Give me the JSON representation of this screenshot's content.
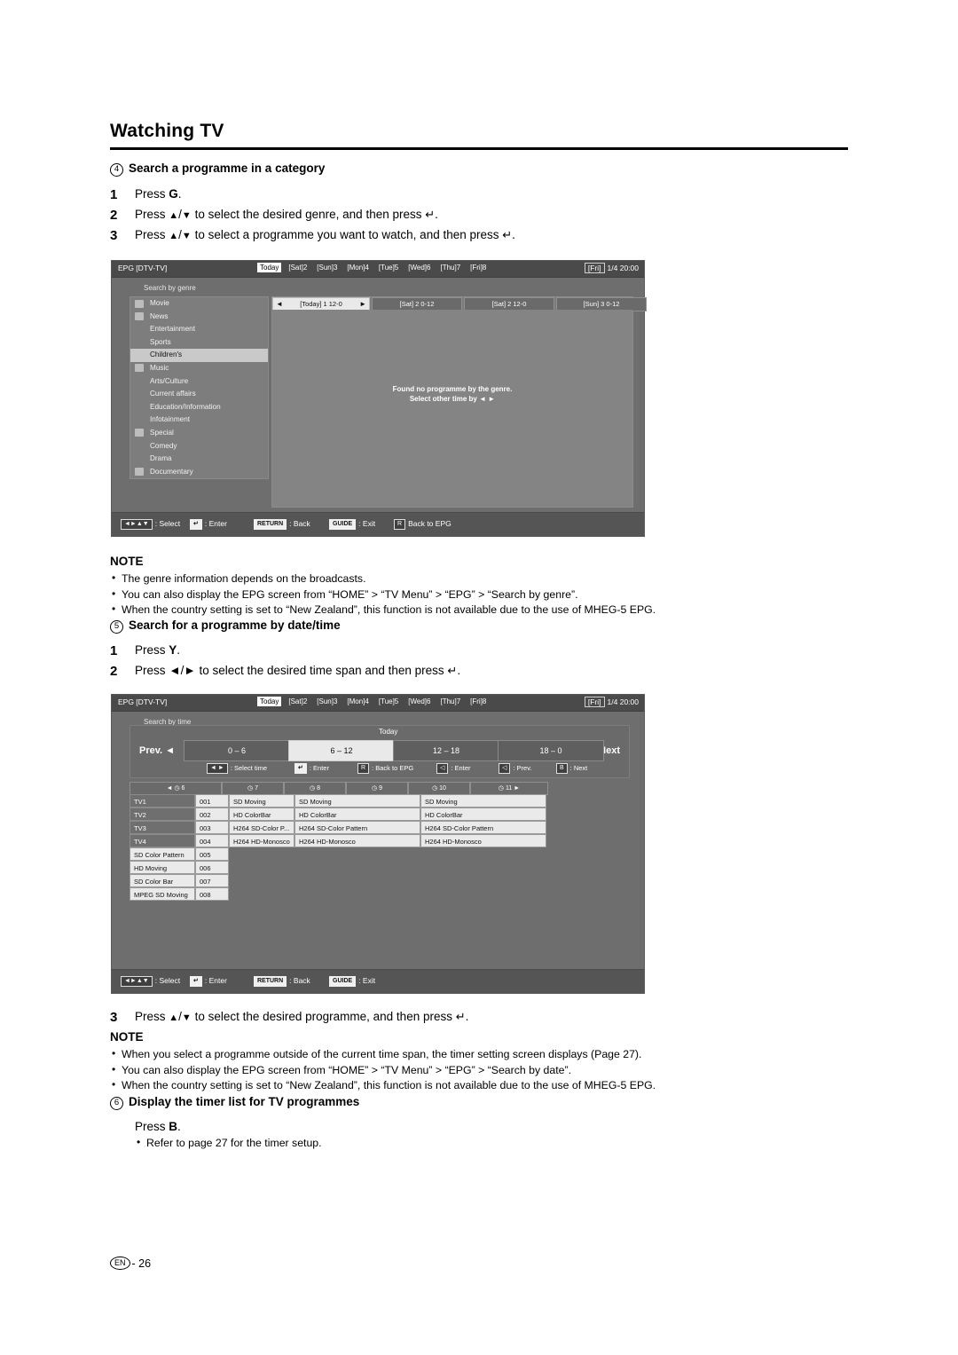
{
  "page": {
    "title": "Watching TV",
    "footer_lang": "EN",
    "footer_page": "26"
  },
  "section4": {
    "marker": "4",
    "heading": "Search a programme in a category",
    "steps": [
      {
        "num": "1",
        "text": "Press G."
      },
      {
        "num": "2",
        "text": "Press ▲/▼ to select the desired genre, and then press ↲."
      },
      {
        "num": "3",
        "text": "Press ▲/▼ to select a programme you want to watch, and then press ↲."
      }
    ]
  },
  "epg_genre": {
    "label": "EPG [DTV-TV]",
    "days": [
      "Today",
      "[Sat]2",
      "[Sun]3",
      "[Mon]4",
      "[Tue]5",
      "[Wed]6",
      "[Thu]7",
      "[Fri]8"
    ],
    "selected_day": "Today",
    "clock_day": "[Fri]",
    "clock_date": "1/4",
    "clock_time": "20:00",
    "sub_label": "Search by genre",
    "genres": [
      {
        "label": "Movie",
        "icon": true,
        "selected": false
      },
      {
        "label": "News",
        "icon": true,
        "selected": false
      },
      {
        "label": "Entertainment",
        "icon": false,
        "selected": false
      },
      {
        "label": "Sports",
        "icon": false,
        "selected": false
      },
      {
        "label": "Children's",
        "icon": false,
        "selected": true
      },
      {
        "label": "Music",
        "icon": true,
        "selected": false
      },
      {
        "label": "Arts/Culture",
        "icon": false,
        "selected": false
      },
      {
        "label": "Current affairs",
        "icon": false,
        "selected": false
      },
      {
        "label": "Education/Information",
        "icon": false,
        "selected": false
      },
      {
        "label": "Infotainment",
        "icon": false,
        "selected": false
      },
      {
        "label": "Special",
        "icon": true,
        "selected": false
      },
      {
        "label": "Comedy",
        "icon": false,
        "selected": false
      },
      {
        "label": "Drama",
        "icon": false,
        "selected": false
      },
      {
        "label": "Documentary",
        "icon": true,
        "selected": false
      }
    ],
    "columns": [
      {
        "label": "[Today] 1 12-0",
        "selected": true
      },
      {
        "label": "[Sat] 2 0-12",
        "selected": false
      },
      {
        "label": "[Sat] 2 12-0",
        "selected": false
      },
      {
        "label": "[Sun] 3 0-12",
        "selected": false
      }
    ],
    "message_line1": "Found no programme by the genre.",
    "message_line2": "Select other time by ◄ ►",
    "legend": [
      {
        "key": "◄►▲▼",
        "text": ": Select",
        "style": "plain"
      },
      {
        "key": "↲",
        "text": ": Enter",
        "style": "white"
      },
      {
        "key": "RETURN",
        "text": ": Back",
        "style": "white"
      },
      {
        "key": "GUIDE",
        "text": ": Exit",
        "style": "white"
      },
      {
        "key": "R",
        "text": "Back to EPG",
        "style": "plain"
      }
    ]
  },
  "note1": {
    "title": "NOTE",
    "items": [
      "The genre information depends on the broadcasts.",
      "You can also display the EPG screen from “HOME” > “TV Menu” > “EPG” > “Search by genre”.",
      "When the country setting is set to “New Zealand”, this function is not available due to the use of MHEG-5 EPG."
    ]
  },
  "section5": {
    "marker": "5",
    "heading": "Search for a programme by date/time",
    "steps": [
      {
        "num": "1",
        "text": "Press Y."
      },
      {
        "num": "2",
        "text": "Press ◄/► to select the desired time span and then press ↲."
      }
    ],
    "step3": {
      "num": "3",
      "text": "Press ▲/▼ to select the desired programme, and then press ↲."
    }
  },
  "epg_time": {
    "label": "EPG [DTV-TV]",
    "days": [
      "Today",
      "[Sat]2",
      "[Sun]3",
      "[Mon]4",
      "[Tue]5",
      "[Wed]6",
      "[Thu]7",
      "[Fri]8"
    ],
    "selected_day": "Today",
    "clock_day": "[Fri]",
    "clock_date": "1/4",
    "clock_time": "20:00",
    "sub_label": "Search by time",
    "today_label": "Today",
    "prev_label": "Prev.",
    "next_label": "Next",
    "spans": [
      {
        "label": "0 – 6",
        "selected": false
      },
      {
        "label": "6 – 12",
        "selected": true
      },
      {
        "label": "12 – 18",
        "selected": false
      },
      {
        "label": "18 – 0",
        "selected": false
      }
    ],
    "inner_legend": [
      {
        "key": "◄ ►",
        "text": ": Select time",
        "style": "plain"
      },
      {
        "key": "↲",
        "text": ": Enter",
        "style": "white"
      },
      {
        "key": "R",
        "text": ": Back to EPG",
        "style": "plain"
      },
      {
        "key": "◁",
        "text": ": Enter",
        "style": "plain"
      },
      {
        "key": "◁",
        "text": ": Prev.",
        "style": "plain"
      },
      {
        "key": "B",
        "text": ": Next",
        "style": "plain"
      }
    ],
    "hour_headers": [
      "6",
      "7",
      "8",
      "9",
      "10",
      "11"
    ],
    "channels": [
      {
        "name": "TV1",
        "num": "001",
        "cells": [
          "SD Moving",
          "SD Moving",
          "SD Moving"
        ]
      },
      {
        "name": "TV2",
        "num": "002",
        "cells": [
          "HD ColorBar",
          "HD ColorBar",
          "HD ColorBar"
        ]
      },
      {
        "name": "TV3",
        "num": "003",
        "cells": [
          "H264 SD-Color P...",
          "H264 SD-Color Pattern",
          "H264 SD-Color Pattern"
        ]
      },
      {
        "name": "TV4",
        "num": "004",
        "cells": [
          "H264 HD-Monosco",
          "H264 HD-Monosco",
          "H264 HD-Monosco"
        ]
      },
      {
        "name": "SD Color Pattern",
        "num": "005",
        "cells": []
      },
      {
        "name": "HD Moving",
        "num": "006",
        "cells": []
      },
      {
        "name": "SD Color Bar",
        "num": "007",
        "cells": []
      },
      {
        "name": "MPEG SD Moving",
        "num": "008",
        "cells": []
      }
    ],
    "legend": [
      {
        "key": "◄►▲▼",
        "text": ": Select",
        "style": "plain"
      },
      {
        "key": "↲",
        "text": ": Enter",
        "style": "white"
      },
      {
        "key": "RETURN",
        "text": ": Back",
        "style": "white"
      },
      {
        "key": "GUIDE",
        "text": ": Exit",
        "style": "white"
      }
    ]
  },
  "note2": {
    "title": "NOTE",
    "items": [
      "When you select a programme outside of the current time span, the timer setting screen displays (Page 27).",
      "You can also display the EPG screen from “HOME” > “TV Menu” > “EPG” > “Search by date”.",
      "When the country setting is set to “New Zealand”, this function is not available due to the use of MHEG-5 EPG."
    ]
  },
  "section6": {
    "marker": "6",
    "heading": "Display the timer list for TV programmes",
    "press": "Press B.",
    "note": "Refer to page 27 for the timer setup."
  }
}
